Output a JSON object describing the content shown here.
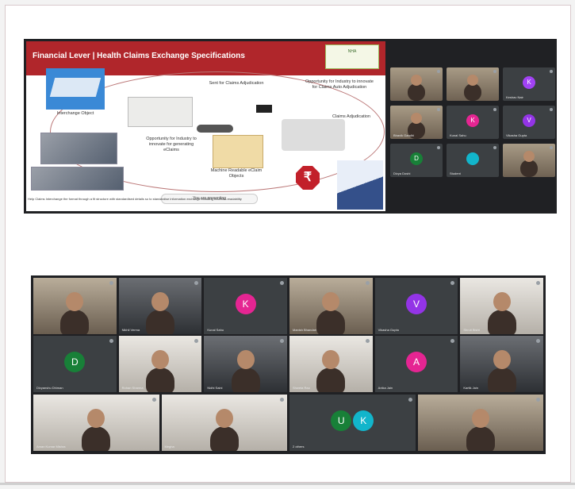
{
  "slide": {
    "title": "Financial Lever | Health Claims Exchange Specifications",
    "labels": {
      "interchange": "Interchange Object",
      "sent_for_claims": "Sent for Claims Adjudication",
      "opportunity": "Opportunity for Industry to innovate for generating eClaims",
      "machine_readable": "Machine Readable eClaim Objects",
      "opportunity_industry": "Opportunity for Industry to innovate for Claims Auto Adjudication",
      "claims_adjudication": "Claims Adjudication"
    },
    "rupee_symbol": "₹",
    "note": "Help Claims Interchange the format through a fit structure with standardised details so to standardise information exchange enabling machine-readability"
  },
  "meet_toolbar": "You are presenting",
  "top_tiles": [
    {
      "name": "",
      "avatar": "",
      "color": "",
      "camera": true
    },
    {
      "name": "",
      "avatar": "",
      "color": "",
      "camera": true
    },
    {
      "name": "Keshav Nair",
      "avatar": "K",
      "color": "#a142f4",
      "camera": false
    },
    {
      "name": "Bhavik Gandhi",
      "avatar": "",
      "color": "",
      "camera": true
    },
    {
      "name": "Kunal Sahu",
      "avatar": "K",
      "color": "#e52592",
      "camera": false
    },
    {
      "name": "Vikasha Gupta",
      "avatar": "V",
      "color": "#9334e6",
      "camera": false
    },
    {
      "name": "Divya Doshi",
      "avatar": "D",
      "color": "#188038",
      "camera": false
    },
    {
      "name": "Student",
      "avatar": "",
      "color": "#12b5cb",
      "camera": false
    },
    {
      "name": "",
      "avatar": "",
      "color": "",
      "camera": true
    }
  ],
  "bottom_tiles": [
    {
      "name": "",
      "avatar": "",
      "color": "",
      "style": "cam"
    },
    {
      "name": "Nikhil Verma",
      "avatar": "",
      "color": "",
      "style": "cam dark"
    },
    {
      "name": "Kunal Sahu",
      "avatar": "K",
      "color": "#e52592",
      "style": ""
    },
    {
      "name": "Manish Bhandari",
      "avatar": "",
      "color": "",
      "style": "cam"
    },
    {
      "name": "Vikasha Gupta",
      "avatar": "V",
      "color": "#9334e6",
      "style": ""
    },
    {
      "name": "Shruti Bisht",
      "avatar": "",
      "color": "",
      "style": "cam light"
    },
    {
      "name": "Divyanshu Dhiman",
      "avatar": "D",
      "color": "#188038",
      "style": ""
    },
    {
      "name": "Rohan Sharma",
      "avatar": "",
      "color": "",
      "style": "cam light"
    },
    {
      "name": "Nidhi Saini",
      "avatar": "",
      "color": "",
      "style": "cam dark"
    },
    {
      "name": "Shweta Rao",
      "avatar": "",
      "color": "",
      "style": "cam light"
    },
    {
      "name": "Anika Jain",
      "avatar": "A",
      "color": "#e52592",
      "style": ""
    },
    {
      "name": "Kartik Jain",
      "avatar": "",
      "color": "",
      "style": "cam dark"
    },
    {
      "name": "Aman Kumar Mishra",
      "avatar": "",
      "color": "",
      "style": "cam light"
    },
    {
      "name": "Megha",
      "avatar": "",
      "color": "",
      "style": "cam light"
    },
    {
      "name": "2 others",
      "avatar": "UK",
      "color": "#12b5cb",
      "style": ""
    },
    {
      "name": "",
      "avatar": "",
      "color": "",
      "style": "cam"
    }
  ]
}
